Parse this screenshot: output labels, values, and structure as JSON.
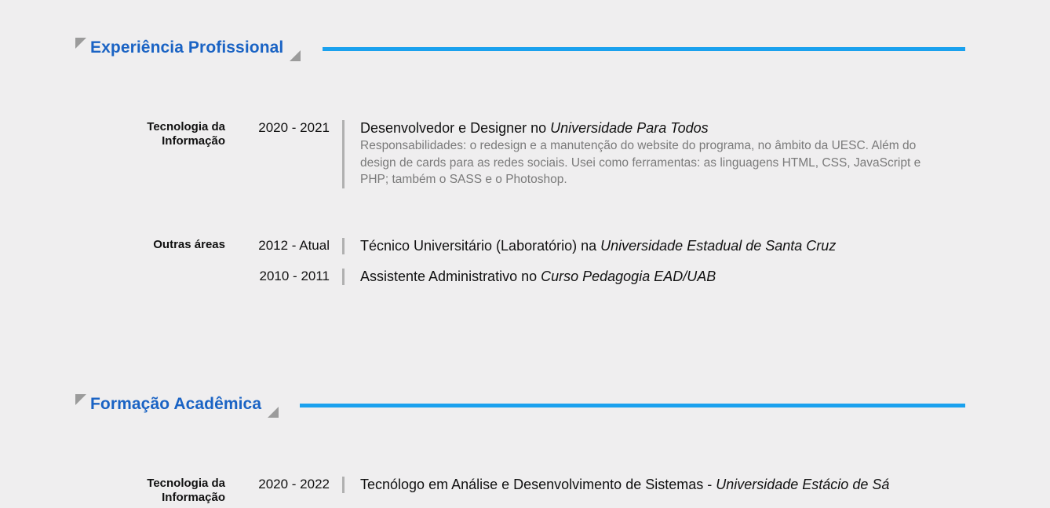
{
  "experience": {
    "title": "Experiência Profissional",
    "groups": [
      {
        "category": [
          "Tecnologia da",
          "Informação"
        ],
        "entries": [
          {
            "years": "2020 - 2021",
            "role": "Desenvolvedor e Designer no ",
            "org": "Universidade Para Todos",
            "description": "Responsabilidades: o redesign e a manutenção do website do programa, no âmbito da UESC. Além do design de cards para as redes sociais. Usei como ferramentas: as linguagens HTML, CSS, JavaScript e PHP; também o SASS e o Photoshop."
          }
        ]
      },
      {
        "category": [
          "Outras áreas"
        ],
        "entries": [
          {
            "years": "2012 - Atual",
            "role": "Técnico Universitário (Laboratório) na ",
            "org": "Universidade Estadual de Santa Cruz"
          },
          {
            "years": "2010 - 2011",
            "role": "Assistente Administrativo no ",
            "org": "Curso Pedagogia EAD/UAB"
          }
        ]
      }
    ]
  },
  "education": {
    "title": "Formação Acadêmica",
    "groups": [
      {
        "category": [
          "Tecnologia da",
          "Informação"
        ],
        "entries": [
          {
            "years": "2020 - 2022",
            "role": "Tecnólogo em Análise e Desenvolvimento de Sistemas - ",
            "org": "Universidade Estácio de Sá"
          }
        ]
      }
    ]
  },
  "colors": {
    "accent_title": "#1a63c4",
    "accent_rule": "#1aa1ee",
    "corner": "#9b9b9b",
    "background": "#efeeef"
  }
}
